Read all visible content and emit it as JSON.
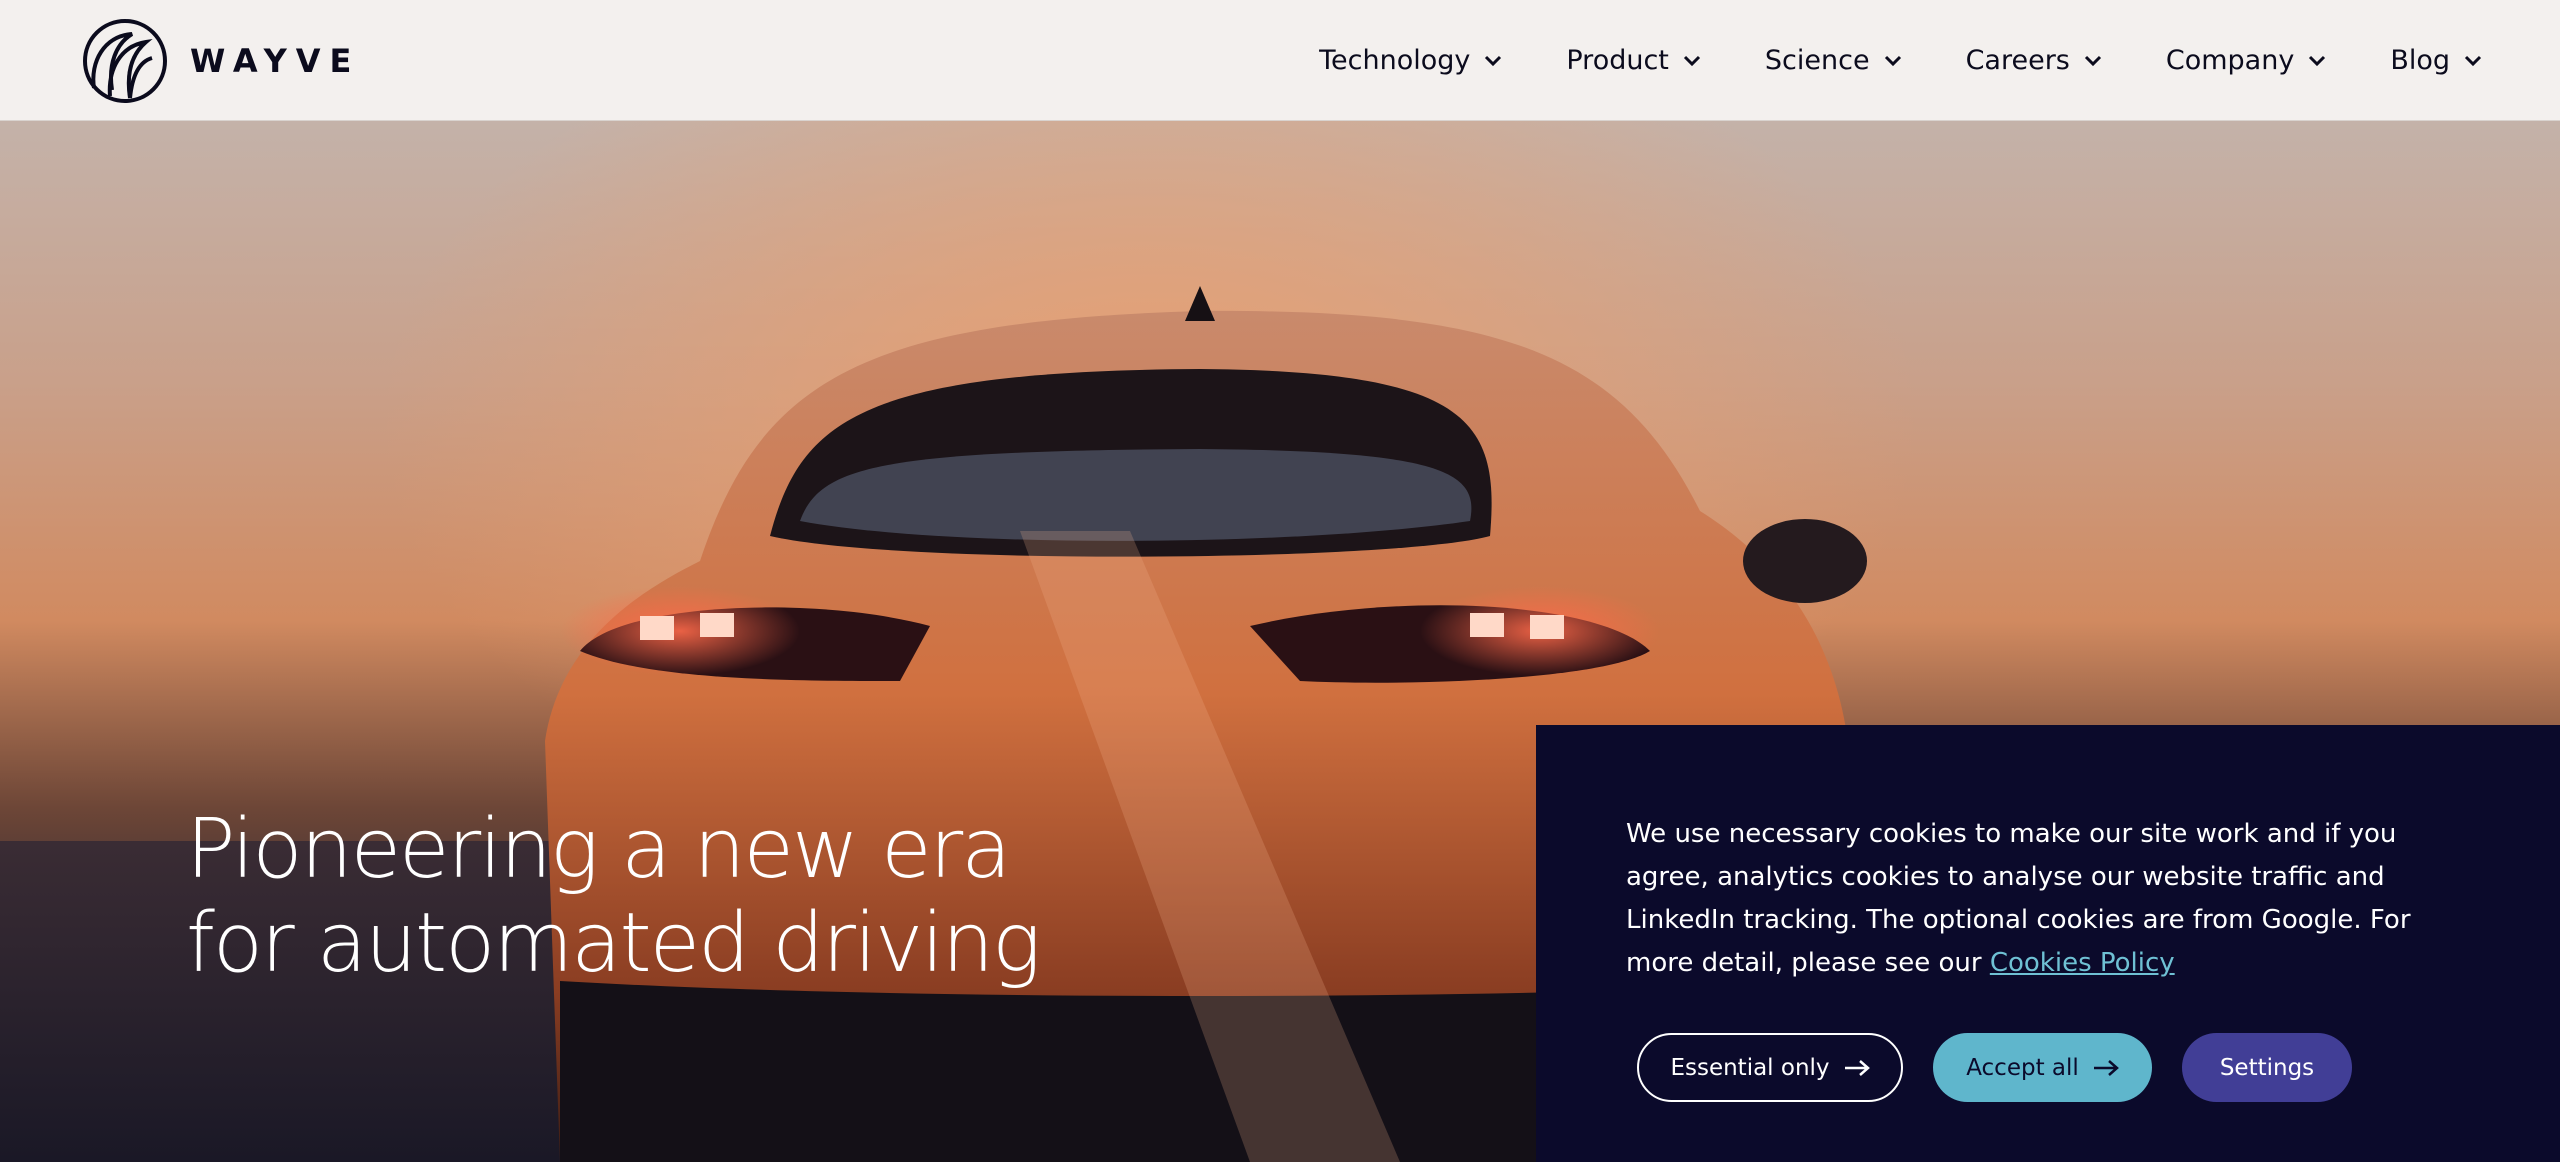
{
  "brand": {
    "name": "WAYVE",
    "logo_icon": "wayve-wave-logo"
  },
  "nav": {
    "items": [
      {
        "label": "Technology",
        "icon": "chevron-down-icon"
      },
      {
        "label": "Product",
        "icon": "chevron-down-icon"
      },
      {
        "label": "Science",
        "icon": "chevron-down-icon"
      },
      {
        "label": "Careers",
        "icon": "chevron-down-icon"
      },
      {
        "label": "Company",
        "icon": "chevron-down-icon"
      },
      {
        "label": "Blog",
        "icon": "chevron-down-icon"
      }
    ]
  },
  "hero": {
    "heading_line1": "Pioneering a new era",
    "heading_line2": "for automated driving"
  },
  "cookie_banner": {
    "text": "We use necessary cookies to make our site work and if you agree, analytics cookies to analyse our website traffic and LinkedIn tracking. The optional cookies are from Google. For more detail, please see our",
    "link_label": "Cookies Policy",
    "buttons": {
      "essential_label": "Essential only",
      "accept_label": "Accept all",
      "settings_label": "Settings"
    }
  },
  "colors": {
    "header_bg": "#f3f0ee",
    "banner_bg": "#0b0a2b",
    "accept_button": "#5fb6cc",
    "settings_button": "#413e96",
    "link": "#6fc1d4",
    "text_dark": "#0b0b1d"
  }
}
